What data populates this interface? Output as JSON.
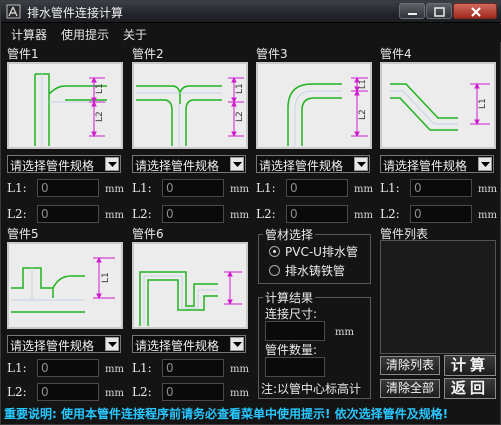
{
  "window": {
    "title": "排水管件连接计算"
  },
  "menu": [
    "计算器",
    "使用提示",
    "关于"
  ],
  "pipes": [
    {
      "label": "管件1",
      "select": "请选择管件规格",
      "l1_label": "L1:",
      "l1_value": "0",
      "l2_label": "L2:",
      "l2_value": "0",
      "unit": "mm",
      "icon": "tee-fitting-icon"
    },
    {
      "label": "管件2",
      "select": "请选择管件规格",
      "l1_label": "L1:",
      "l1_value": "0",
      "l2_label": "L2:",
      "l2_value": "0",
      "unit": "mm",
      "icon": "tee-fitting-icon"
    },
    {
      "label": "管件3",
      "select": "请选择管件规格",
      "l1_label": "L1:",
      "l1_value": "0",
      "l2_label": "L2:",
      "l2_value": "0",
      "unit": "mm",
      "icon": "elbow-90-icon"
    },
    {
      "label": "管件4",
      "select": "请选择管件规格",
      "l1_label": "L1:",
      "l1_value": "0",
      "l2_label": "L2:",
      "l2_value": "0",
      "unit": "mm",
      "icon": "elbow-45-icon"
    },
    {
      "label": "管件5",
      "select": "请选择管件规格",
      "l1_label": "L1:",
      "l1_value": "0",
      "l2_label": "L2:",
      "l2_value": "0",
      "unit": "mm",
      "icon": "tee-fitting-icon"
    },
    {
      "label": "管件6",
      "select": "请选择管件规格",
      "l1_label": "L1:",
      "l1_value": "0",
      "l2_label": "L2:",
      "l2_value": "0",
      "unit": "mm",
      "icon": "p-trap-icon"
    }
  ],
  "material": {
    "title": "管材选择",
    "options": [
      "PVC-U排水管",
      "排水铸铁管"
    ],
    "selected": "PVC-U排水管"
  },
  "result": {
    "title": "计算结果",
    "size_label": "连接尺寸:",
    "size_value": "",
    "size_unit": "mm",
    "count_label": "管件数量:",
    "count_value": "",
    "note": "注:以管中心标高计"
  },
  "list": {
    "title": "管件列表"
  },
  "buttons": {
    "clear_list": "清除列表",
    "clear_all": "清除全部",
    "calc": "计算",
    "back": "返回"
  },
  "notice": "重要说明: 使用本管件连接程序前请务必查看菜单中使用提示! 依次选择管件及规格!",
  "colors": {
    "notice": "#27c7ff",
    "pipe_outline": "#1fb31f",
    "dimension": "#d01cd0"
  }
}
